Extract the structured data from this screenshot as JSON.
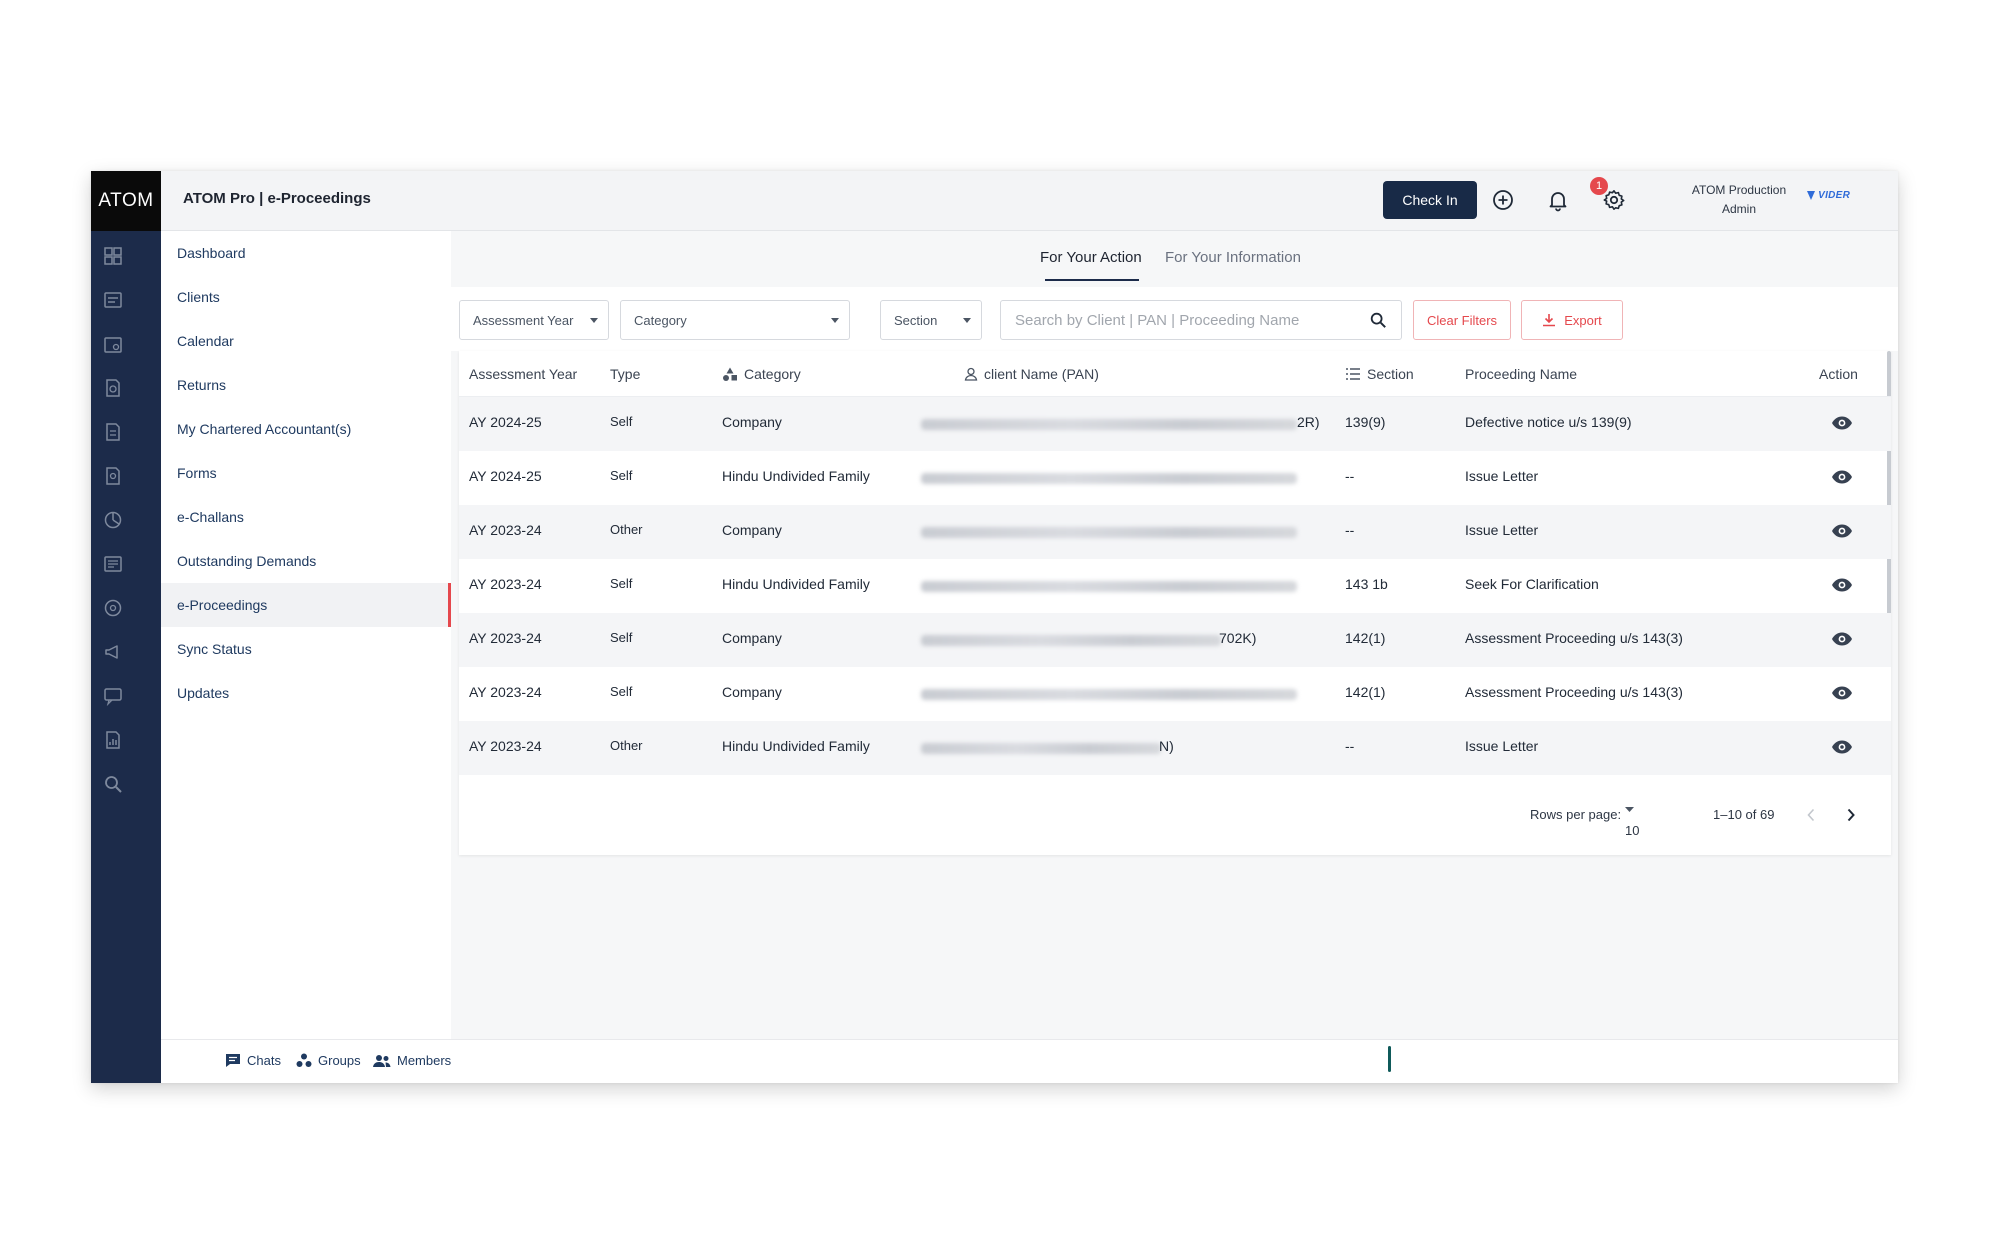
{
  "app": {
    "logo": "ATOM",
    "title": "ATOM Pro | e-Proceedings",
    "check_in_label": "Check In",
    "notification_count": "1",
    "user_name": "ATOM Production",
    "user_role": "Admin",
    "brand": "VIDER"
  },
  "sidebar": {
    "items": [
      {
        "label": "Dashboard"
      },
      {
        "label": "Clients"
      },
      {
        "label": "Calendar"
      },
      {
        "label": "Returns"
      },
      {
        "label": "My Chartered Accountant(s)"
      },
      {
        "label": "Forms"
      },
      {
        "label": "e-Challans"
      },
      {
        "label": "Outstanding Demands"
      },
      {
        "label": "e-Proceedings"
      },
      {
        "label": "Sync Status"
      },
      {
        "label": "Updates"
      }
    ],
    "active": "e-Proceedings"
  },
  "tabs": {
    "action": "For Your Action",
    "information": "For Your Information"
  },
  "filters": {
    "assessment_year": "Assessment Year",
    "category": "Category",
    "section": "Section",
    "search_placeholder": "Search by Client | PAN | Proceeding Name",
    "clear_label": "Clear Filters",
    "export_label": "Export"
  },
  "table": {
    "headers": {
      "assessment_year": "Assessment Year",
      "type": "Type",
      "category": "Category",
      "client": "client Name (PAN)",
      "section": "Section",
      "proceeding": "Proceeding Name",
      "action": "Action"
    },
    "rows": [
      {
        "ay": "AY 2024-25",
        "type": "Self",
        "category": "Company",
        "client_tail": "2R)",
        "section": "139(9)",
        "proceeding": "Defective notice u/s 139(9)"
      },
      {
        "ay": "AY 2024-25",
        "type": "Self",
        "category": "Hindu Undivided Family",
        "client_tail": "",
        "section": "--",
        "proceeding": "Issue Letter"
      },
      {
        "ay": "AY 2023-24",
        "type": "Other",
        "category": "Company",
        "client_tail": "",
        "section": "--",
        "proceeding": "Issue Letter"
      },
      {
        "ay": "AY 2023-24",
        "type": "Self",
        "category": "Hindu Undivided Family",
        "client_tail": "",
        "section": "143 1b",
        "proceeding": "Seek For Clarification"
      },
      {
        "ay": "AY 2023-24",
        "type": "Self",
        "category": "Company",
        "client_tail": "702K)",
        "section": "142(1)",
        "proceeding": "Assessment Proceeding u/s 143(3)"
      },
      {
        "ay": "AY 2023-24",
        "type": "Self",
        "category": "Company",
        "client_tail": "",
        "section": "142(1)",
        "proceeding": "Assessment Proceeding u/s 143(3)"
      },
      {
        "ay": "AY 2023-24",
        "type": "Other",
        "category": "Hindu Undivided Family",
        "client_tail": "N)",
        "section": "--",
        "proceeding": "Issue Letter"
      }
    ]
  },
  "pagination": {
    "rows_per_page_label": "Rows per page:",
    "rows_per_page": "10",
    "range": "1–10 of 69"
  },
  "footer": {
    "chats": "Chats",
    "groups": "Groups",
    "members": "Members"
  },
  "colors": {
    "rail": "#1c2b4a",
    "accent": "#e5484d",
    "primary_button": "#182a47"
  }
}
